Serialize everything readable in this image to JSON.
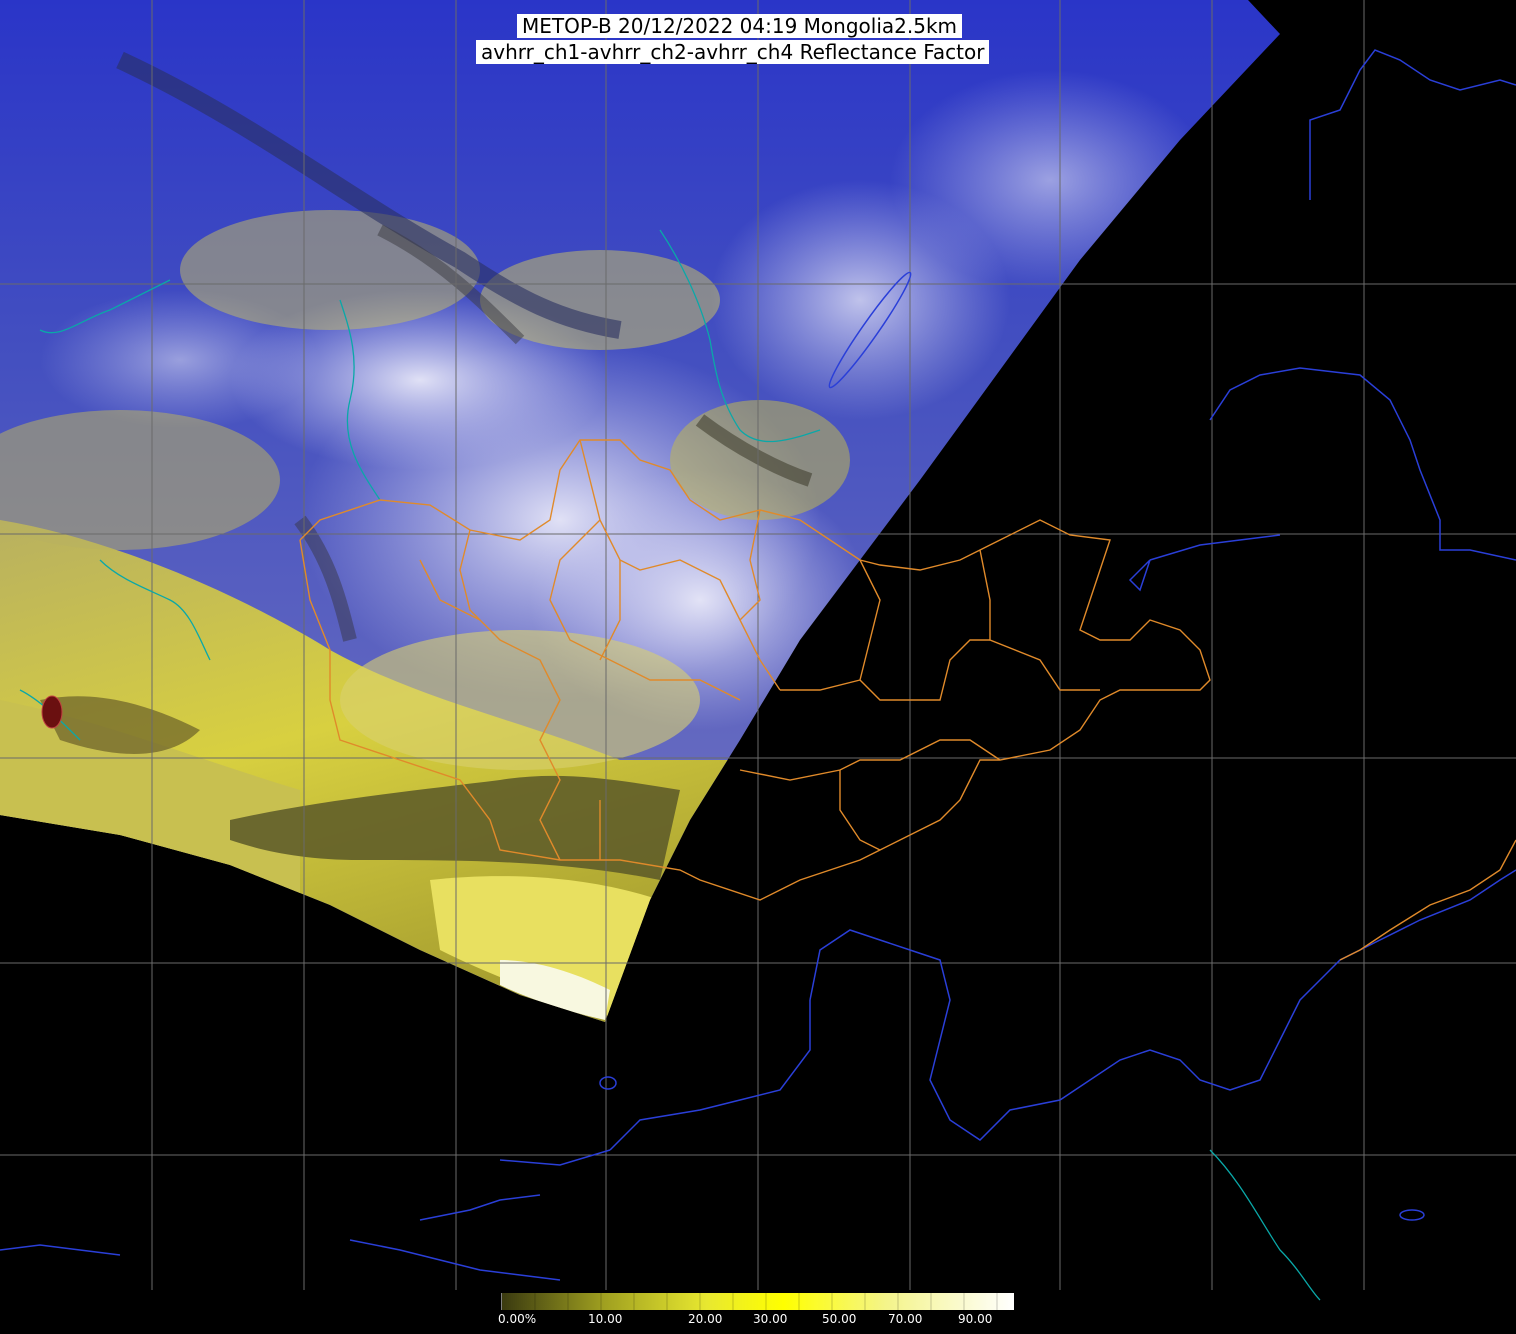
{
  "header": {
    "title": "METOP-B 20/12/2022 04:19 Mongolia2.5km",
    "subtitle": "avhrr_ch1-avhrr_ch2-avhrr_ch4 Reflectance Factor"
  },
  "colorbar": {
    "labels": [
      "0.00%",
      "10.00",
      "20.00",
      "30.00",
      "50.00",
      "70.00",
      "90.00"
    ],
    "stops": [
      "#3a3a10",
      "#a0a020",
      "#e8e830",
      "#ffff00",
      "#f4f48a",
      "#ffffff"
    ]
  },
  "colors": {
    "coastline": "#2a3fd8",
    "province_border": "#e08a2a",
    "river": "#0aa8a8",
    "graticule": "#6a6a6a",
    "background": "#000000"
  }
}
